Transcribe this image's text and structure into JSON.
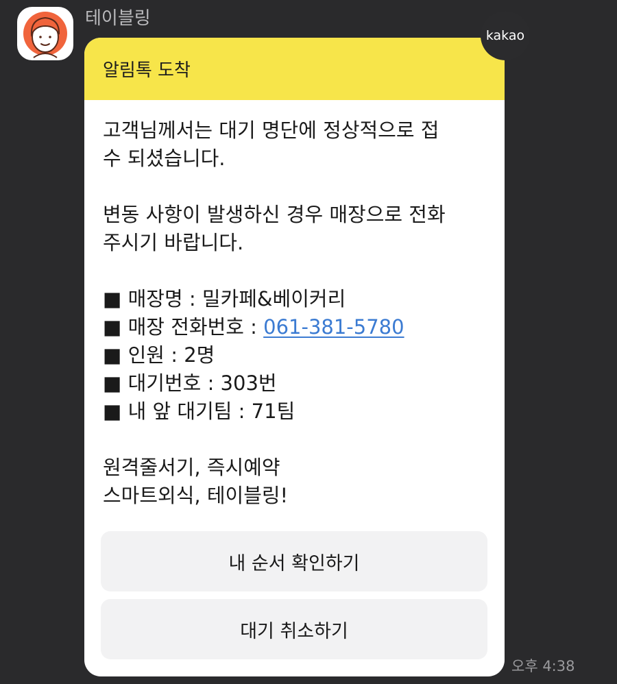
{
  "sender": {
    "name": "테이블링",
    "avatar_icon": "cartoon-person-avatar-icon"
  },
  "message": {
    "header_title": "알림톡 도착",
    "body": {
      "para1_line1": "고객님께서는 대기 명단에 정상적으로 접",
      "para1_line2": "수 되셨습니다.",
      "para2_line1": "변동 사항이 발생하신 경우 매장으로 전화",
      "para2_line2": "주시기 바랍니다.",
      "info": {
        "bullet": "■",
        "store_name": " 매장명 : 밀카페&베이커리",
        "store_phone_label": " 매장 전화번호 : ",
        "store_phone_value": "061-381-5780",
        "party_size": " 인원 : 2명",
        "wait_number": " 대기번호 : 303번",
        "teams_ahead": " 내 앞 대기팀 : 71팀"
      },
      "slogan_line1": "원격줄서기, 즉시예약",
      "slogan_line2": "스마트외식, 테이블링!"
    },
    "buttons": {
      "check_order": "내 순서 확인하기",
      "cancel_wait": "대기 취소하기"
    },
    "badge": "kakao",
    "timestamp": "오후 4:38"
  },
  "colors": {
    "background": "#2a2a2c",
    "header_yellow": "#f7e54a",
    "link_blue": "#3b7bd2",
    "button_gray": "#f2f2f3"
  }
}
